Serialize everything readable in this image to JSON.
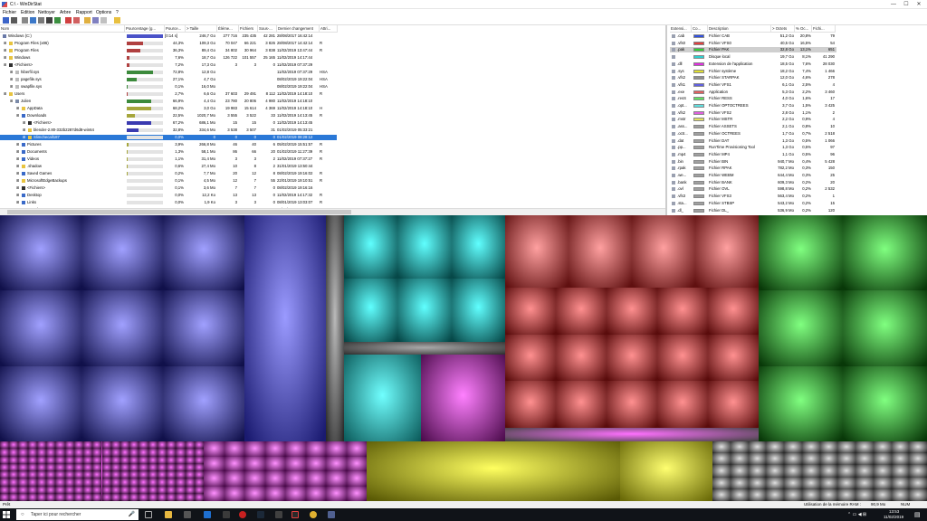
{
  "window": {
    "title": "C:\\ - WinDirStat",
    "min_glyph": "—",
    "max_glyph": "☐",
    "close_glyph": "✕"
  },
  "menu": [
    "Fichier",
    "Edition",
    "Nettoyer",
    "Arbre",
    "Rapport",
    "Options",
    "?"
  ],
  "dir_columns": [
    "Nom",
    "Pourcentage (g...",
    "Pource...",
    "> Taille",
    "Éléme...",
    "Fichiers",
    "Sous-...",
    "Dernier changement",
    "Attri..."
  ],
  "dir_rows": [
    {
      "indent": 0,
      "name": "Windows (C:)",
      "bar": "[0:14 s]",
      "pct": "",
      "size": "246,7 Go",
      "items": "277 716",
      "files": "235 435",
      "subdirs": "42 281",
      "date": "28/08/2017 16:42:14",
      "attr": "",
      "fill": 1.0,
      "color": "#4a52c8",
      "icon": "#6a7aa8",
      "sel": false
    },
    {
      "indent": 1,
      "name": "Program Files (x86)",
      "bar": "",
      "pct": "44,3%",
      "size": "109,3 Go",
      "items": "70 047",
      "files": "66 221",
      "subdirs": "3 826",
      "date": "28/08/2017 14:42:14",
      "attr": "R",
      "fill": 0.443,
      "color": "#b04040",
      "icon": "#e8c440",
      "sel": false
    },
    {
      "indent": 1,
      "name": "Program Files",
      "bar": "",
      "pct": "36,3%",
      "size": "89,4 Go",
      "items": "34 802",
      "files": "30 964",
      "subdirs": "3 838",
      "date": "11/02/2019 13:47:44",
      "attr": "R",
      "fill": 0.363,
      "color": "#b04040",
      "icon": "#e8c440",
      "sel": false
    },
    {
      "indent": 1,
      "name": "Windows",
      "bar": "",
      "pct": "7,6%",
      "size": "18,7 Go",
      "items": "126 722",
      "files": "101 557",
      "subdirs": "25 165",
      "date": "11/02/2019 14:17:44",
      "attr": "",
      "fill": 0.076,
      "color": "#b04040",
      "icon": "#e8c440",
      "sel": false
    },
    {
      "indent": 1,
      "name": "<Fichiers>",
      "bar": "",
      "pct": "7,2%",
      "size": "17,3 Go",
      "items": "3",
      "files": "3",
      "subdirs": "0",
      "date": "11/02/2019 07:37:29",
      "attr": "",
      "fill": 0.072,
      "color": "#b04040",
      "icon": "#303030",
      "sel": false
    },
    {
      "indent": 2,
      "name": "hiberfil.sys",
      "bar": "",
      "pct": "72,8%",
      "size": "12,8 Go",
      "items": "",
      "files": "",
      "subdirs": "",
      "date": "11/02/2019 07:37:29",
      "attr": "HSA",
      "fill": 0.728,
      "color": "#3c8a3c",
      "icon": "#bbbbbb",
      "sel": false
    },
    {
      "indent": 2,
      "name": "pagefile.sys",
      "bar": "",
      "pct": "27,1%",
      "size": "4,7 Go",
      "items": "",
      "files": "",
      "subdirs": "",
      "date": "08/02/2019 19:22:04",
      "attr": "HSA",
      "fill": 0.271,
      "color": "#3c8a3c",
      "icon": "#bbbbbb",
      "sel": false
    },
    {
      "indent": 2,
      "name": "swapfile.sys",
      "bar": "",
      "pct": "0,1%",
      "size": "16,0 Mo",
      "items": "",
      "files": "",
      "subdirs": "",
      "date": "08/02/2019 19:22:04",
      "attr": "HSA",
      "fill": 0.005,
      "color": "#3c8a3c",
      "icon": "#bbbbbb",
      "sel": false
    },
    {
      "indent": 1,
      "name": "Users",
      "bar": "",
      "pct": "2,7%",
      "size": "6,6 Go",
      "items": "37 603",
      "files": "29 491",
      "subdirs": "8 112",
      "date": "11/02/2019 14:18:10",
      "attr": "R",
      "fill": 0.027,
      "color": "#b04040",
      "icon": "#e8c440",
      "sel": false
    },
    {
      "indent": 2,
      "name": "Julien",
      "bar": "",
      "pct": "66,9%",
      "size": "4,4 Go",
      "items": "23 780",
      "files": "20 806",
      "subdirs": "4 980",
      "date": "11/02/2019 14:18:10",
      "attr": "",
      "fill": 0.669,
      "color": "#3c8a3c",
      "icon": "#7a8aa8",
      "sel": false
    },
    {
      "indent": 3,
      "name": "AppData",
      "bar": "",
      "pct": "68,2%",
      "size": "3,0 Go",
      "items": "19 983",
      "files": "15 614",
      "subdirs": "4 369",
      "date": "11/02/2019 14:18:10",
      "attr": "H",
      "fill": 0.682,
      "color": "#a6a63c",
      "icon": "#e8c440",
      "sel": false
    },
    {
      "indent": 3,
      "name": "Downloads",
      "bar": "",
      "pct": "22,5%",
      "size": "1020,7 Mo",
      "items": "3 555",
      "files": "3 522",
      "subdirs": "33",
      "date": "11/02/2019 14:13:45",
      "attr": "R",
      "fill": 0.225,
      "color": "#a6a63c",
      "icon": "#3a6ac8",
      "sel": false
    },
    {
      "indent": 4,
      "name": "<Fichiers>",
      "bar": "",
      "pct": "67,2%",
      "size": "686,1 Mo",
      "items": "15",
      "files": "15",
      "subdirs": "0",
      "date": "11/02/2019 14:13:45",
      "attr": "",
      "fill": 0.672,
      "color": "#3a3ab0",
      "icon": "#303030",
      "sel": false
    },
    {
      "indent": 4,
      "name": "blender-2.80-332b2287d6d8-win64",
      "bar": "",
      "pct": "32,8%",
      "size": "334,6 Mo",
      "items": "3 538",
      "files": "3 507",
      "subdirs": "31",
      "date": "01/02/2019 05:33:21",
      "attr": "",
      "fill": 0.328,
      "color": "#3a3ab0",
      "icon": "#e8c440",
      "sel": false
    },
    {
      "indent": 4,
      "name": "Slimchecall187",
      "bar": "",
      "pct": "0,0%",
      "size": "0",
      "items": "0",
      "files": "0",
      "subdirs": "0",
      "date": "01/02/2019 08:28:12",
      "attr": "",
      "fill": 0.0,
      "color": "#3a3ab0",
      "icon": "#e8c440",
      "sel": true
    },
    {
      "indent": 3,
      "name": "Pictures",
      "bar": "",
      "pct": "3,9%",
      "size": "266,8 Mo",
      "items": "46",
      "files": "40",
      "subdirs": "6",
      "date": "05/02/2019 15:51:57",
      "attr": "R",
      "fill": 0.039,
      "color": "#a6a63c",
      "icon": "#3a6ac8",
      "sel": false
    },
    {
      "indent": 3,
      "name": "Documents",
      "bar": "",
      "pct": "1,3%",
      "size": "58,1 Mo",
      "items": "86",
      "files": "66",
      "subdirs": "20",
      "date": "01/02/2019 11:27:39",
      "attr": "R",
      "fill": 0.013,
      "color": "#a6a63c",
      "icon": "#3a6ac8",
      "sel": false
    },
    {
      "indent": 3,
      "name": "Videos",
      "bar": "",
      "pct": "1,1%",
      "size": "31,4 Mo",
      "items": "3",
      "files": "3",
      "subdirs": "2",
      "date": "11/02/2019 07:37:27",
      "attr": "R",
      "fill": 0.011,
      "color": "#a6a63c",
      "icon": "#3a6ac8",
      "sel": false
    },
    {
      "indent": 3,
      "name": ".shadow",
      "bar": "",
      "pct": "0,6%",
      "size": "27,4 Mo",
      "items": "10",
      "files": "8",
      "subdirs": "2",
      "date": "31/01/2019 13:50:44",
      "attr": "",
      "fill": 0.006,
      "color": "#a6a63c",
      "icon": "#e8c440",
      "sel": false
    },
    {
      "indent": 3,
      "name": "Saved Games",
      "bar": "",
      "pct": "0,2%",
      "size": "7,7 Mo",
      "items": "20",
      "files": "12",
      "subdirs": "8",
      "date": "08/02/2019 19:16:02",
      "attr": "R",
      "fill": 0.002,
      "color": "#a6a63c",
      "icon": "#3a6ac8",
      "sel": false
    },
    {
      "indent": 3,
      "name": "MicrosoftEdgeBackups",
      "bar": "",
      "pct": "0,1%",
      "size": "4,5 Mo",
      "items": "12",
      "files": "7",
      "subdirs": "55",
      "date": "22/01/2019 19:10:51",
      "attr": "R",
      "fill": 0.001,
      "color": "#a6a63c",
      "icon": "#e8c440",
      "sel": false
    },
    {
      "indent": 3,
      "name": "<Fichiers>",
      "bar": "",
      "pct": "0,1%",
      "size": "3,6 Mo",
      "items": "7",
      "files": "7",
      "subdirs": "0",
      "date": "08/02/2019 19:16:16",
      "attr": "",
      "fill": 0.001,
      "color": "#a6a63c",
      "icon": "#303030",
      "sel": false
    },
    {
      "indent": 3,
      "name": "Desktop",
      "bar": "",
      "pct": "0,0%",
      "size": "12,2 Ko",
      "items": "13",
      "files": "13",
      "subdirs": "0",
      "date": "11/02/2019 14:17:32",
      "attr": "R",
      "fill": 0.0,
      "color": "#a6a63c",
      "icon": "#3a6ac8",
      "sel": false
    },
    {
      "indent": 3,
      "name": "Links",
      "bar": "",
      "pct": "0,0%",
      "size": "1,9 Ko",
      "items": "3",
      "files": "3",
      "subdirs": "0",
      "date": "08/01/2019 13:03:07",
      "attr": "R",
      "fill": 0.0,
      "color": "#a6a63c",
      "icon": "#3a6ac8",
      "sel": false
    },
    {
      "indent": 3,
      "name": "Searches",
      "bar": "",
      "pct": "0,0%",
      "size": "1,8 Ko",
      "items": "4",
      "files": "4",
      "subdirs": "0",
      "date": "08/01/2019 13:03:07",
      "attr": "R",
      "fill": 0.0,
      "color": "#a6a63c",
      "icon": "#3a6ac8",
      "sel": false
    }
  ],
  "ext_columns": [
    "Extensi...",
    "Co...",
    "Description",
    "> Octets",
    "% Oc...",
    "Fichi..."
  ],
  "ext_rows": [
    {
      "ext": ".cab",
      "color": "#3050e0",
      "desc": "Fichier CAB",
      "bytes": "51,2 Go",
      "pct": "20,8%",
      "files": "79",
      "sel": false
    },
    {
      "ext": ".vfs0",
      "color": "#e04040",
      "desc": "Fichier VFS0",
      "bytes": "40,5 Go",
      "pct": "16,5%",
      "files": "54",
      "sel": false
    },
    {
      "ext": ".pak",
      "color": "#30d030",
      "desc": "Fichier PAK",
      "bytes": "32,8 Go",
      "pct": "13,1%",
      "files": "651",
      "sel": true
    },
    {
      "ext": "",
      "color": "#30d0d0",
      "desc": "Disque local",
      "bytes": "19,7 Go",
      "pct": "8,1%",
      "files": "41 290",
      "sel": false
    },
    {
      "ext": ".dll",
      "color": "#e030e0",
      "desc": "Extension de l'application",
      "bytes": "18,5 Go",
      "pct": "7,6%",
      "files": "28 030",
      "sel": false
    },
    {
      "ext": ".sys",
      "color": "#e0e030",
      "desc": "Fichier système",
      "bytes": "18,2 Go",
      "pct": "7,4%",
      "files": "1 466",
      "sel": false
    },
    {
      "ext": ".vfs2",
      "color": "#909090",
      "desc": "Fichier STARPAK",
      "bytes": "12,0 Go",
      "pct": "4,6%",
      "files": "278",
      "sel": false
    },
    {
      "ext": ".vfs1",
      "color": "#6060e0",
      "desc": "Fichier VFS1",
      "bytes": "6,1 Go",
      "pct": "2,5%",
      "files": "4",
      "sel": false
    },
    {
      "ext": ".exe",
      "color": "#e06060",
      "desc": "Application",
      "bytes": "5,3 Go",
      "pct": "2,2%",
      "files": "3 460",
      "sel": false
    },
    {
      "ext": ".resS",
      "color": "#60e060",
      "desc": "Fichier RESS",
      "bytes": "4,0 Go",
      "pct": "1,6%",
      "files": "17",
      "sel": false
    },
    {
      "ext": ".opt...",
      "color": "#60e0e0",
      "desc": "Fichier OPTOCTREES",
      "bytes": "3,7 Go",
      "pct": "1,5%",
      "files": "3 425",
      "sel": false
    },
    {
      "ext": ".vfs2",
      "color": "#e060e0",
      "desc": "Fichier VFS2",
      "bytes": "2,8 Go",
      "pct": "1,1%",
      "files": "2",
      "sel": false
    },
    {
      "ext": ".mstr",
      "color": "#e0e060",
      "desc": "Fichier MSTR",
      "bytes": "2,2 Go",
      "pct": "0,9%",
      "files": "4",
      "sel": false
    },
    {
      "ext": ".ass...",
      "color": "#a0a0a0",
      "desc": "Fichier ASSETS",
      "bytes": "2,1 Go",
      "pct": "0,8%",
      "files": "10",
      "sel": false
    },
    {
      "ext": ".octr...",
      "color": "#a0a0a0",
      "desc": "Fichier OCTREES",
      "bytes": "1,7 Go",
      "pct": "0,7%",
      "files": "2 518",
      "sel": false
    },
    {
      "ext": ".dat",
      "color": "#a0a0a0",
      "desc": "Fichier DAT",
      "bytes": "1,3 Go",
      "pct": "0,5%",
      "files": "1 066",
      "sel": false
    },
    {
      "ext": ".pp...",
      "color": "#a0a0a0",
      "desc": "RunTime Provisioning Tool",
      "bytes": "1,3 Go",
      "pct": "0,5%",
      "files": "97",
      "sel": false
    },
    {
      "ext": ".mp4",
      "color": "#a0a0a0",
      "desc": "Fichier MP4",
      "bytes": "1,1 Go",
      "pct": "0,5%",
      "files": "96",
      "sel": false
    },
    {
      "ext": ".bin",
      "color": "#a0a0a0",
      "desc": "Fichier BIN",
      "bytes": "940,7 Mo",
      "pct": "0,4%",
      "files": "5 428",
      "sel": false
    },
    {
      "ext": ".rpak",
      "color": "#a0a0a0",
      "desc": "Fichier RPAK",
      "bytes": "782,2 Mo",
      "pct": "0,3%",
      "files": "150",
      "sel": false
    },
    {
      "ext": ".we...",
      "color": "#a0a0a0",
      "desc": "Fichier WEBM",
      "bytes": "644,4 Mo",
      "pct": "0,3%",
      "files": "25",
      "sel": false
    },
    {
      "ext": ".bank",
      "color": "#a0a0a0",
      "desc": "Fichier BANK",
      "bytes": "609,3 Mo",
      "pct": "0,2%",
      "files": "20",
      "sel": false
    },
    {
      "ext": ".ovl",
      "color": "#a0a0a0",
      "desc": "Fichier OVL",
      "bytes": "598,8 Mo",
      "pct": "0,2%",
      "files": "2 532",
      "sel": false
    },
    {
      "ext": ".vfs3",
      "color": "#a0a0a0",
      "desc": "Fichier VFS3",
      "bytes": "563,4 Mo",
      "pct": "0,2%",
      "files": "1",
      "sel": false
    },
    {
      "ext": ".sta...",
      "color": "#a0a0a0",
      "desc": "Fichier STBSP",
      "bytes": "543,2 Mo",
      "pct": "0,2%",
      "files": "15",
      "sel": false
    },
    {
      "ext": ".dl_",
      "color": "#a0a0a0",
      "desc": "Fichier DL_",
      "bytes": "536,9 Mo",
      "pct": "0,2%",
      "files": "120",
      "sel": false
    }
  ],
  "status": {
    "left": "Prêt",
    "ram_label": "Utilisation de la mémoire RAM :",
    "ram_value": "90,9 Mo",
    "num": "NUM"
  },
  "taskbar": {
    "search_placeholder": "Taper ici pour rechercher",
    "time": "13:53",
    "date": "11/02/2019"
  }
}
